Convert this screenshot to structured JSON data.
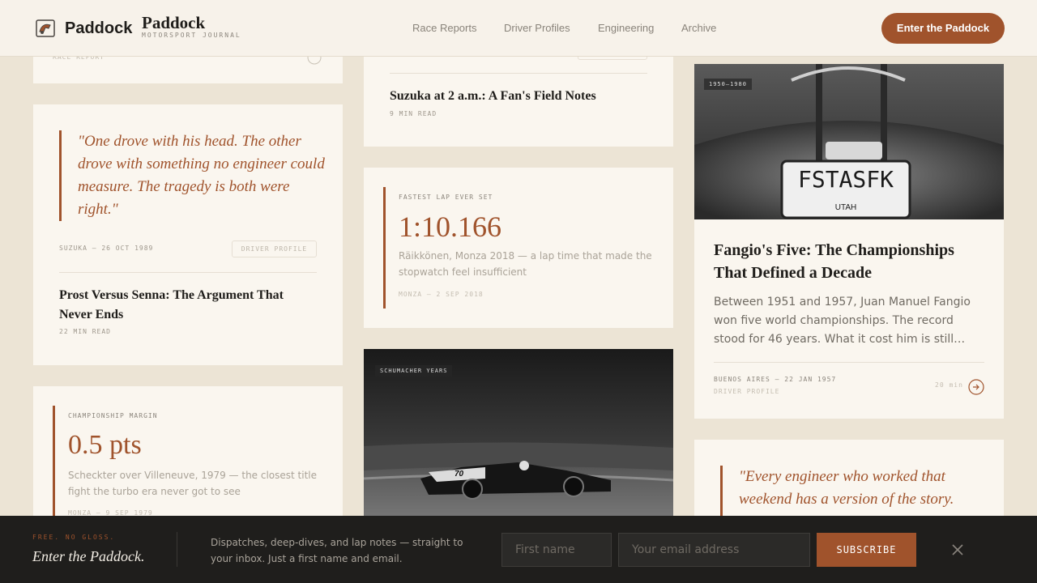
{
  "header": {
    "logo_word": "Paddock",
    "brand_title": "Paddock",
    "brand_subtitle": "MOTORSPORT JOURNAL",
    "nav": [
      "Race Reports",
      "Driver Profiles",
      "Engineering",
      "Archive"
    ],
    "cta": "Enter the Paddock"
  },
  "col1": {
    "top_card": {
      "meta": "RACE REPORT"
    },
    "quote_card": {
      "quote": "\"One drove with his head. The other drove with something no engineer could measure. The tragedy is both were right.\"",
      "meta": "SUZUKA — 26 OCT 1989",
      "tag": "DRIVER PROFILE",
      "title": "Prost Versus Senna: The Argument That Never Ends",
      "read": "22 MIN READ"
    },
    "stat_card": {
      "eyebrow": "CHAMPIONSHIP MARGIN",
      "value": "0.5 pts",
      "caption": "Scheckter over Villeneuve, 1979 — the closest title fight the turbo era never got to see",
      "meta": "MONZA — 9 SEP 1979"
    }
  },
  "col2": {
    "top_card": {
      "title": "Suzuka at 2 a.m.: A Fan's Field Notes",
      "read": "9 MIN READ"
    },
    "stat_card": {
      "eyebrow": "FASTEST LAP EVER SET",
      "value": "1:10.166",
      "caption": "Räikkönen, Monza 2018 — a lap time that made the stopwatch feel insufficient",
      "meta": "MONZA — 2 SEP 2018"
    },
    "image_card": {
      "tag": "SCHUMACHER YEARS",
      "car_number": "70"
    }
  },
  "col3": {
    "feature": {
      "tag": "1950–1980",
      "plate": "FSTASFK",
      "plate_state": "UTAH",
      "title": "Fangio's Five: The Championships That Defined a Decade",
      "excerpt": "Between 1951 and 1957, Juan Manuel Fangio won five world championships. The record stood for 46 years. What it cost him is still…",
      "meta": "BUENOS AIRES — 22 JAN 1957",
      "category": "DRIVER PROFILE",
      "read": "20 min"
    },
    "quote_card": {
      "quote": "\"Every engineer who worked that weekend has a version of the story."
    }
  },
  "newsletter": {
    "eyebrow": "FREE. NO GLOSS.",
    "title": "Enter the Paddock.",
    "text": "Dispatches, deep-dives, and lap notes — straight to your inbox. Just a first name and email.",
    "first_name_placeholder": "First name",
    "email_placeholder": "Your email address",
    "subscribe": "SUBSCRIBE"
  },
  "colors": {
    "accent": "#a0532c",
    "background": "#ece4d5",
    "card": "#faf6ef",
    "footer": "#1f1e1c"
  }
}
